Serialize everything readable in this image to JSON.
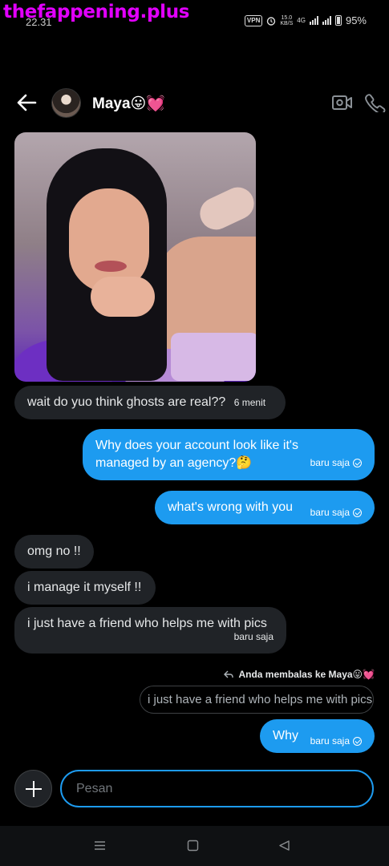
{
  "watermark": "thefappening.plus",
  "status_bar": {
    "time": "22.31",
    "vpn": "VPN",
    "speed": "15.0",
    "speed_unit": "KB/S",
    "network": "4G",
    "battery": "95%",
    "icons": [
      "vpn-icon",
      "alarm-icon",
      "signal-icon",
      "battery-icon"
    ]
  },
  "header": {
    "back_icon": "arrow-left-icon",
    "name": "Maya😛💓",
    "video_icon": "video-camera-icon",
    "call_icon": "phone-icon"
  },
  "messages": [
    {
      "side": "in",
      "text": "wait do yuo think ghosts are real??",
      "time": "6 menit"
    },
    {
      "side": "out",
      "text": "Why does your account look like it's managed by an agency?🤔",
      "time": "baru saja"
    },
    {
      "side": "out",
      "text": "what's wrong with you",
      "time": "baru saja"
    },
    {
      "side": "in",
      "text": "omg no !!"
    },
    {
      "side": "in",
      "text": "i manage it myself !!"
    },
    {
      "side": "in",
      "text": "i just have a friend who helps me with pics",
      "time": "baru saja"
    },
    {
      "side": "out",
      "text": "Why",
      "time": "baru saja"
    }
  ],
  "reply": {
    "note": "Anda membalas ke Maya😛💓",
    "quoted": "i just have a friend who helps me with pics"
  },
  "composer": {
    "placeholder": "Pesan",
    "add_icon": "plus-icon"
  },
  "colors": {
    "accent": "#1d9bf0",
    "incoming_bubble": "#202327",
    "background": "#000000"
  },
  "nav": [
    "menu-icon",
    "home-square-icon",
    "back-triangle-icon"
  ]
}
